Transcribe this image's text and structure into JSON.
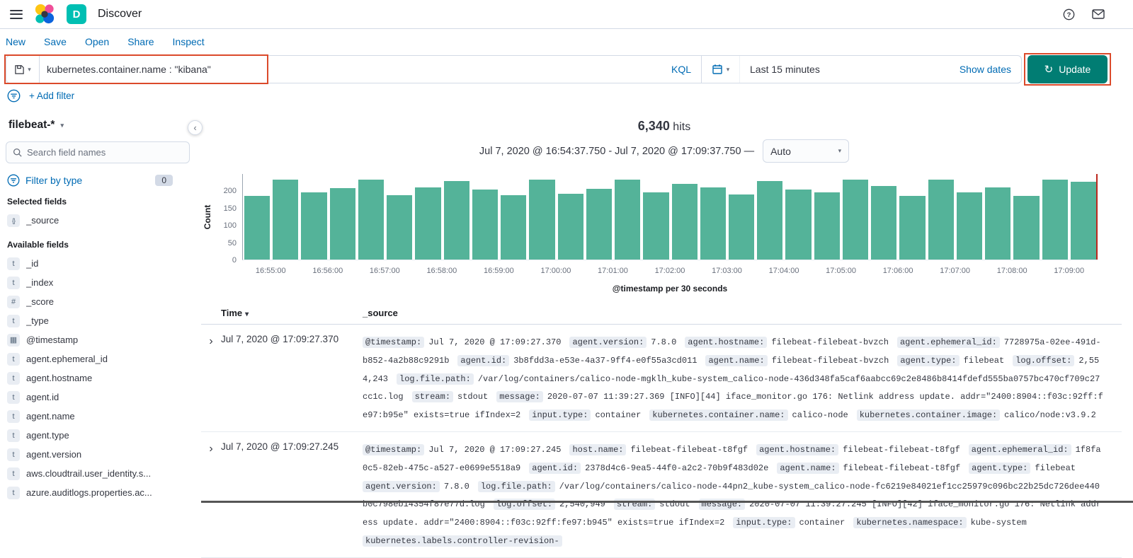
{
  "colors": {
    "accent_blue": "#006BB4",
    "update_button": "#017D73",
    "bar_fill": "#54B399",
    "annotation": "#DB4A2B",
    "time_marker": "#BD271E"
  },
  "icons": {
    "chevron_down": "▾",
    "collapse": "‹",
    "refresh": "↻",
    "expand_row": "›",
    "sort_desc": "▾",
    "field_text": "t",
    "field_number": "#",
    "field_date": "▦",
    "field_source": "{}"
  },
  "header": {
    "title": "Discover",
    "space_badge": "D"
  },
  "nav": {
    "items": [
      "New",
      "Save",
      "Open",
      "Share",
      "Inspect"
    ]
  },
  "query_bar": {
    "query": "kubernetes.container.name : \"kibana\"",
    "kql_label": "KQL",
    "time_range": "Last 15 minutes",
    "show_dates_label": "Show dates",
    "update_label": "Update"
  },
  "filter_bar": {
    "add_filter": "+ Add filter"
  },
  "sidebar": {
    "index_pattern": "filebeat-*",
    "search_placeholder": "Search field names",
    "filter_by_type_label": "Filter by type",
    "filter_count": "0",
    "selected_heading": "Selected fields",
    "selected_fields": [
      {
        "name": "_source",
        "type": "source"
      }
    ],
    "available_heading": "Available fields",
    "available_fields": [
      {
        "name": "_id",
        "type": "t"
      },
      {
        "name": "_index",
        "type": "t"
      },
      {
        "name": "_score",
        "type": "#"
      },
      {
        "name": "_type",
        "type": "t"
      },
      {
        "name": "@timestamp",
        "type": "date"
      },
      {
        "name": "agent.ephemeral_id",
        "type": "t"
      },
      {
        "name": "agent.hostname",
        "type": "t"
      },
      {
        "name": "agent.id",
        "type": "t"
      },
      {
        "name": "agent.name",
        "type": "t"
      },
      {
        "name": "agent.type",
        "type": "t"
      },
      {
        "name": "agent.version",
        "type": "t"
      },
      {
        "name": "aws.cloudtrail.user_identity.s...",
        "type": "t"
      },
      {
        "name": "azure.auditlogs.properties.ac...",
        "type": "t"
      }
    ]
  },
  "results": {
    "hits": "6,340",
    "hits_suffix": "hits",
    "range": "Jul 7, 2020 @ 16:54:37.750 - Jul 7, 2020 @ 17:09:37.750 —",
    "interval": "Auto"
  },
  "chart_data": {
    "type": "bar",
    "title": "6,340 hits",
    "xlabel": "@timestamp per 30 seconds",
    "ylabel": "Count",
    "ylim": [
      0,
      250
    ],
    "yticks": [
      0,
      50,
      100,
      150,
      200
    ],
    "bucket_interval": "30 seconds",
    "x_tick_labels": [
      "16:55:00",
      "16:56:00",
      "16:57:00",
      "16:58:00",
      "16:59:00",
      "17:00:00",
      "17:01:00",
      "17:02:00",
      "17:03:00",
      "17:04:00",
      "17:05:00",
      "17:06:00",
      "17:07:00",
      "17:08:00",
      "17:09:00"
    ],
    "values": [
      185,
      233,
      196,
      209,
      234,
      188,
      210,
      229,
      205,
      188,
      233,
      192,
      206,
      234,
      196,
      221,
      211,
      190,
      229,
      204,
      196,
      233,
      215,
      186,
      233,
      196,
      210,
      186,
      233,
      228
    ],
    "grid": false,
    "legend": false
  },
  "table": {
    "time_header": "Time",
    "source_header": "_source",
    "rows": [
      {
        "time": "Jul 7, 2020 @ 17:09:27.370",
        "source": [
          {
            "k": "@timestamp:",
            "v": "Jul 7, 2020 @ 17:09:27.370"
          },
          {
            "k": "agent.version:",
            "v": "7.8.0"
          },
          {
            "k": "agent.hostname:",
            "v": "filebeat-filebeat-bvzch"
          },
          {
            "k": "agent.ephemeral_id:",
            "v": "7728975a-02ee-491d-b852-4a2b88c9291b"
          },
          {
            "k": "agent.id:",
            "v": "3b8fdd3a-e53e-4a37-9ff4-e0f55a3cd011"
          },
          {
            "k": "agent.name:",
            "v": "filebeat-filebeat-bvzch"
          },
          {
            "k": "agent.type:",
            "v": "filebeat"
          },
          {
            "k": "log.offset:",
            "v": "2,554,243"
          },
          {
            "k": "log.file.path:",
            "v": "/var/log/containers/calico-node-mgklh_kube-system_calico-node-436d348fa5caf6aabcc69c2e8486b8414fdefd555ba0757bc470cf709c27cc1c.log"
          },
          {
            "k": "stream:",
            "v": "stdout"
          },
          {
            "k": "message:",
            "v": "2020-07-07 11:39:27.369 [INFO][44] iface_monitor.go 176: Netlink address update. addr=\"2400:8904::f03c:92ff:fe97:b95e\" exists=true ifIndex=2"
          },
          {
            "k": "input.type:",
            "v": "container"
          },
          {
            "k": "kubernetes.container.name:",
            "v": "calico-node"
          },
          {
            "k": "kubernetes.container.image:",
            "v": "calico/node:v3.9.2"
          }
        ]
      },
      {
        "time": "Jul 7, 2020 @ 17:09:27.245",
        "source": [
          {
            "k": "@timestamp:",
            "v": "Jul 7, 2020 @ 17:09:27.245"
          },
          {
            "k": "host.name:",
            "v": "filebeat-filebeat-t8fgf"
          },
          {
            "k": "agent.hostname:",
            "v": "filebeat-filebeat-t8fgf"
          },
          {
            "k": "agent.ephemeral_id:",
            "v": "1f8fa0c5-82eb-475c-a527-e0699e5518a9"
          },
          {
            "k": "agent.id:",
            "v": "2378d4c6-9ea5-44f0-a2c2-70b9f483d02e"
          },
          {
            "k": "agent.name:",
            "v": "filebeat-filebeat-t8fgf"
          },
          {
            "k": "agent.type:",
            "v": "filebeat"
          },
          {
            "k": "agent.version:",
            "v": "7.8.0"
          },
          {
            "k": "log.file.path:",
            "v": "/var/log/containers/calico-node-44pn2_kube-system_calico-node-fc6219e84021ef1cc25979c096bc22b25dc726dee440b0c798eb14354f87e77d.log"
          },
          {
            "k": "log.offset:",
            "v": "2,540,949"
          },
          {
            "k": "stream:",
            "v": "stdout"
          },
          {
            "k": "message:",
            "v": "2020-07-07 11:39:27.245 [INFO][42] iface_monitor.go 176: Netlink address update. addr=\"2400:8904::f03c:92ff:fe97:b945\" exists=true ifIndex=2"
          },
          {
            "k": "input.type:",
            "v": "container"
          },
          {
            "k": "kubernetes.namespace:",
            "v": "kube-system"
          },
          {
            "k": "kubernetes.labels.controller-revision-",
            "v": ""
          }
        ]
      }
    ]
  }
}
